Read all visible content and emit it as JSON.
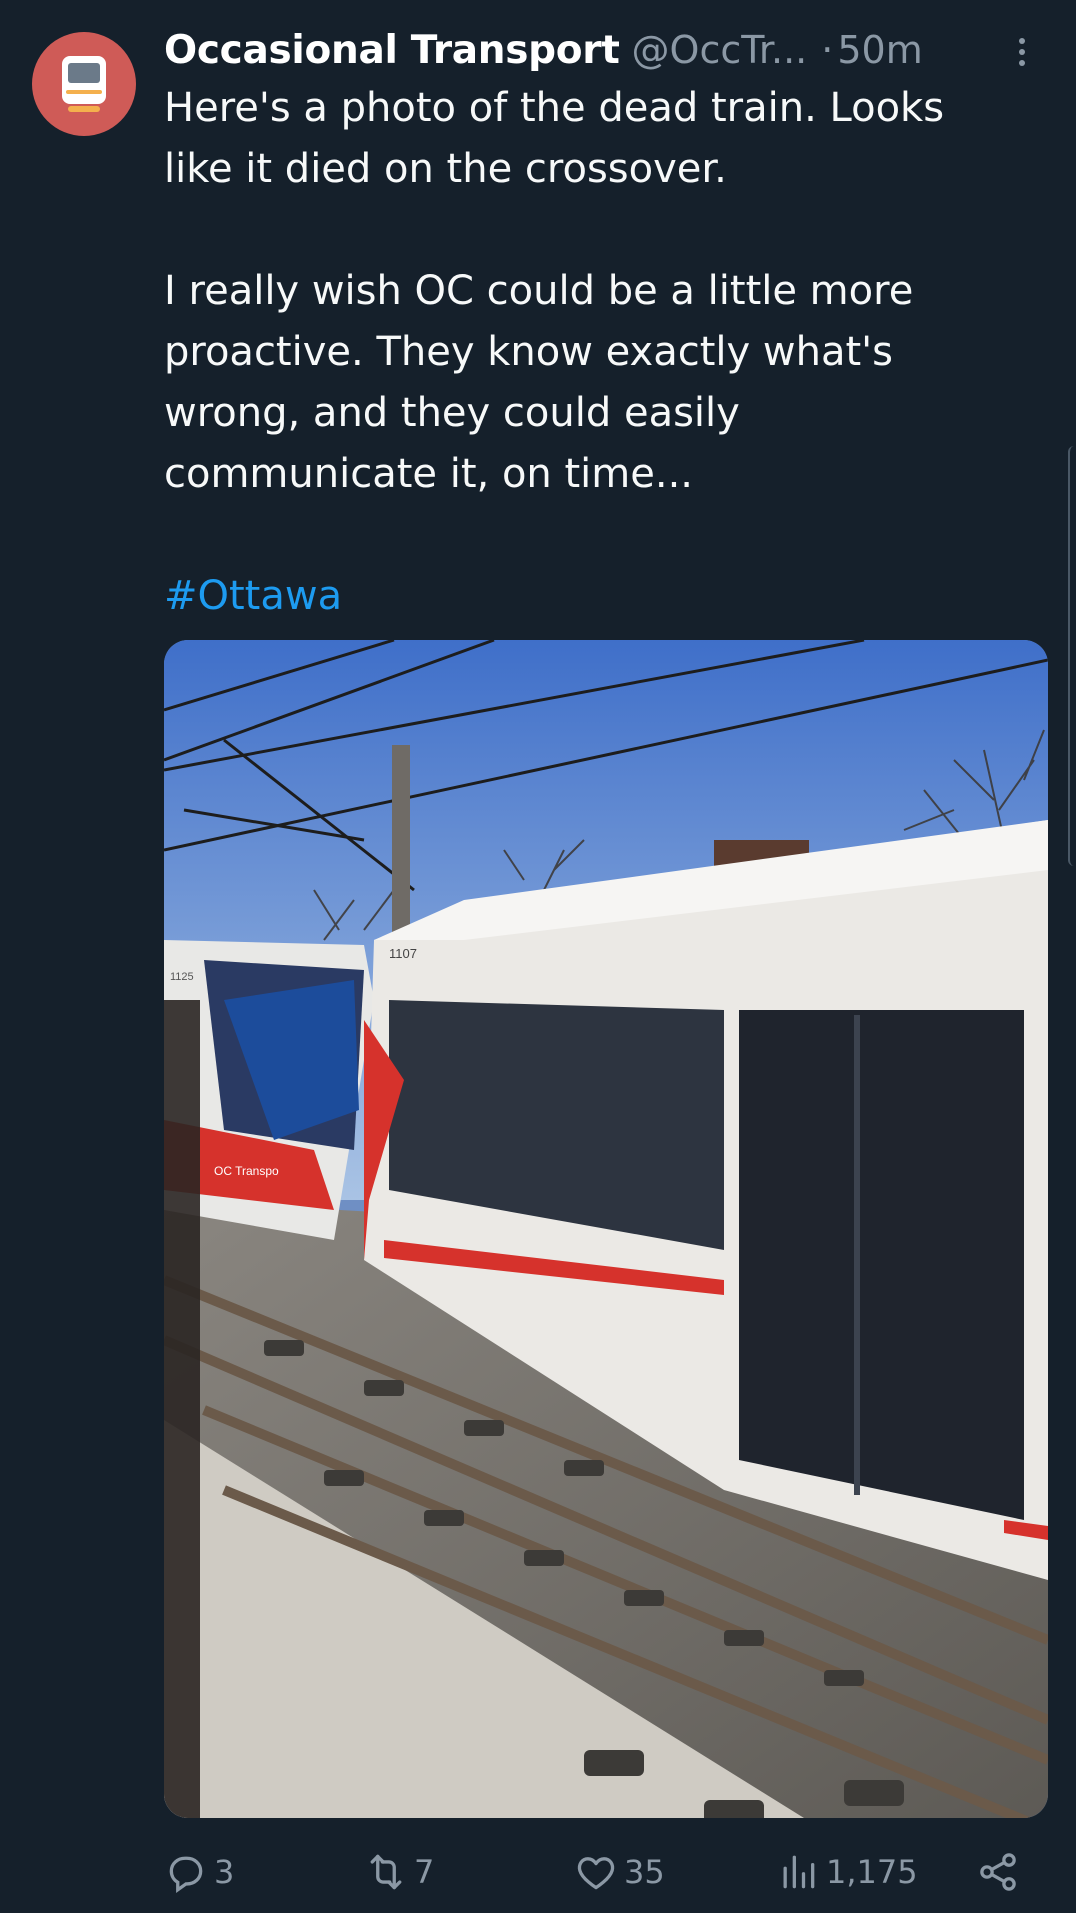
{
  "post": {
    "display_name": "Occasional Transport",
    "handle": "@OccTr...",
    "separator": "·",
    "time": "50m",
    "text_lines_1": [
      "Here's a photo of the dead train. Looks",
      "like it died on the crossover."
    ],
    "text_lines_2": [
      "I really wish OC could be a little more",
      "proactive. They know exactly what's",
      "wrong, and they could easily",
      "communicate it, on time..."
    ],
    "hashtag": "#Ottawa"
  },
  "media": {
    "description_visible_text": {
      "car_number_left": "1125",
      "car_number_right": "1107",
      "brand_text": "OC Transpo"
    }
  },
  "actions": {
    "replies": "3",
    "reposts": "7",
    "likes": "35",
    "views": "1,175"
  },
  "icons": {
    "avatar": "train-icon",
    "more": "more-vertical-icon",
    "reply": "reply-icon",
    "repost": "repost-icon",
    "like": "heart-icon",
    "views": "views-icon",
    "share": "share-icon"
  },
  "colors": {
    "background": "#15202b",
    "secondary_text": "#8b98a5",
    "link": "#1d9bf0",
    "avatar": "#cf5b57"
  }
}
